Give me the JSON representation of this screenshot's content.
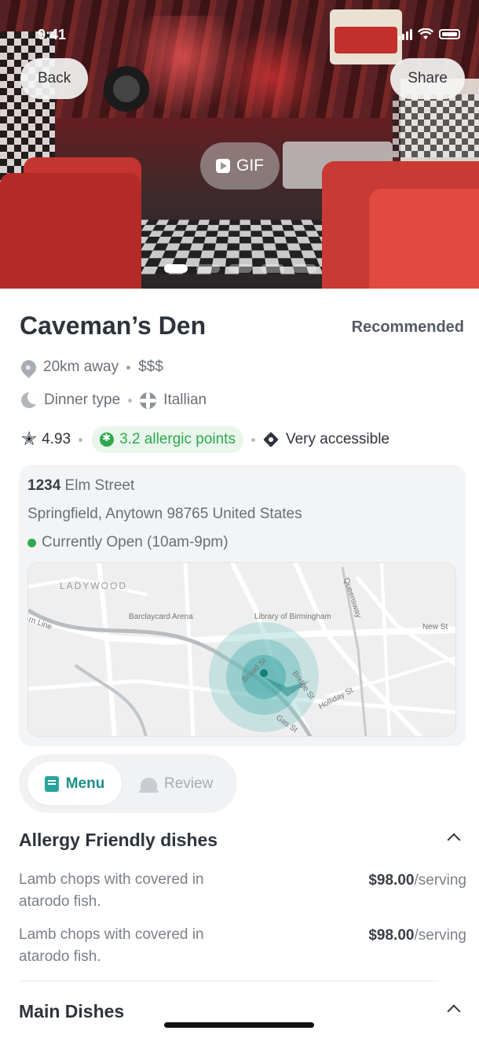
{
  "status": {
    "time": "9:41"
  },
  "hero": {
    "back_label": "Back",
    "share_label": "Share",
    "gif_label": "GIF",
    "carousel": {
      "count": 5,
      "active_index": 0
    }
  },
  "restaurant": {
    "name": "Caveman’s Den",
    "badge": "Recommended",
    "distance": "20km away",
    "price_level": "$$$",
    "meal_type": "Dinner type",
    "cuisine": "Itallian",
    "rating": "4.93",
    "allergic_points": "3.2 allergic points",
    "accessibility": "Very accessible"
  },
  "address": {
    "street_number": "1234",
    "street_name": " Elm Street",
    "city_line": "Springfield, Anytown 98765 United States",
    "open_status": "Currently Open (10am-9pm)"
  },
  "map": {
    "labels": {
      "ladywood": "LADYWOOD",
      "barclaycard": "Barclaycard Arena",
      "library": "Library of Birmingham",
      "queensway": "Queensway",
      "new_st": "New St",
      "broad_st": "Broad St",
      "bridge_st": "Bridge St",
      "holliday_st": "Holliday St",
      "gas_st": "Gas St",
      "line_st": "rn Line"
    }
  },
  "tabs": {
    "menu": "Menu",
    "review": "Review",
    "active": "menu"
  },
  "sections": [
    {
      "title": "Allergy Friendly dishes",
      "expanded": true,
      "dishes": [
        {
          "name": "Lamb chops with covered in atarodo fish.",
          "price": "$98.00",
          "unit": "/serving"
        },
        {
          "name": "Lamb chops with covered in atarodo fish.",
          "price": "$98.00",
          "unit": "/serving"
        }
      ]
    },
    {
      "title": "Main Dishes",
      "expanded": true
    }
  ],
  "colors": {
    "accent_teal": "#1b8f8a",
    "allergy_green": "#2fa84f",
    "open_green": "#2fa84f"
  },
  "icons": [
    "signal-icon",
    "wifi-icon",
    "battery-icon",
    "gif-icon",
    "location-pin-icon",
    "moon-icon",
    "globe-icon",
    "star-icon",
    "allergy-gear-icon",
    "accessibility-icon",
    "menu-book-icon",
    "bell-icon",
    "chevron-up-icon"
  ]
}
